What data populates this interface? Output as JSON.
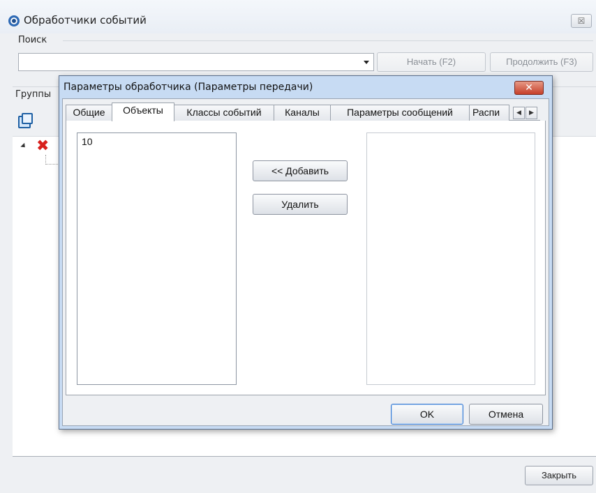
{
  "window": {
    "title": "Обработчики событий",
    "close_label": "☒"
  },
  "search": {
    "legend": "Поиск",
    "combo_value": "",
    "start_button": "Начать (F2)",
    "continue_button": "Продолжить (F3)"
  },
  "groups": {
    "legend": "Группы"
  },
  "footer": {
    "close_button": "Закрыть"
  },
  "dialog": {
    "title": "Параметры обработчика (Параметры передачи)",
    "close_label": "✕",
    "tabs": [
      {
        "label": "Общие",
        "active": false
      },
      {
        "label": "Объекты",
        "active": true
      },
      {
        "label": "Классы событий",
        "active": false
      },
      {
        "label": "Каналы",
        "active": false
      },
      {
        "label": "Параметры сообщений",
        "active": false
      },
      {
        "label": "Распи",
        "active": false
      }
    ],
    "tab_scroll_left": "◀",
    "tab_scroll_right": "▶",
    "left_list_items": [
      "10"
    ],
    "right_list_items": [],
    "add_button": "<< Добавить",
    "remove_button": "Удалить",
    "ok_button": "OK",
    "cancel_button": "Отмена"
  },
  "icons": {
    "app": "settings-gear-icon",
    "toolbar_copy": "copy-icon",
    "tree_node": "red-x-icon",
    "combo_arrow": "dropdown-arrow-icon"
  },
  "colors": {
    "dialog_frame": "#c7dbf3",
    "dialog_close": "#c6402a",
    "tree_error": "#d8201c",
    "default_button_border": "#3b7bd1"
  }
}
